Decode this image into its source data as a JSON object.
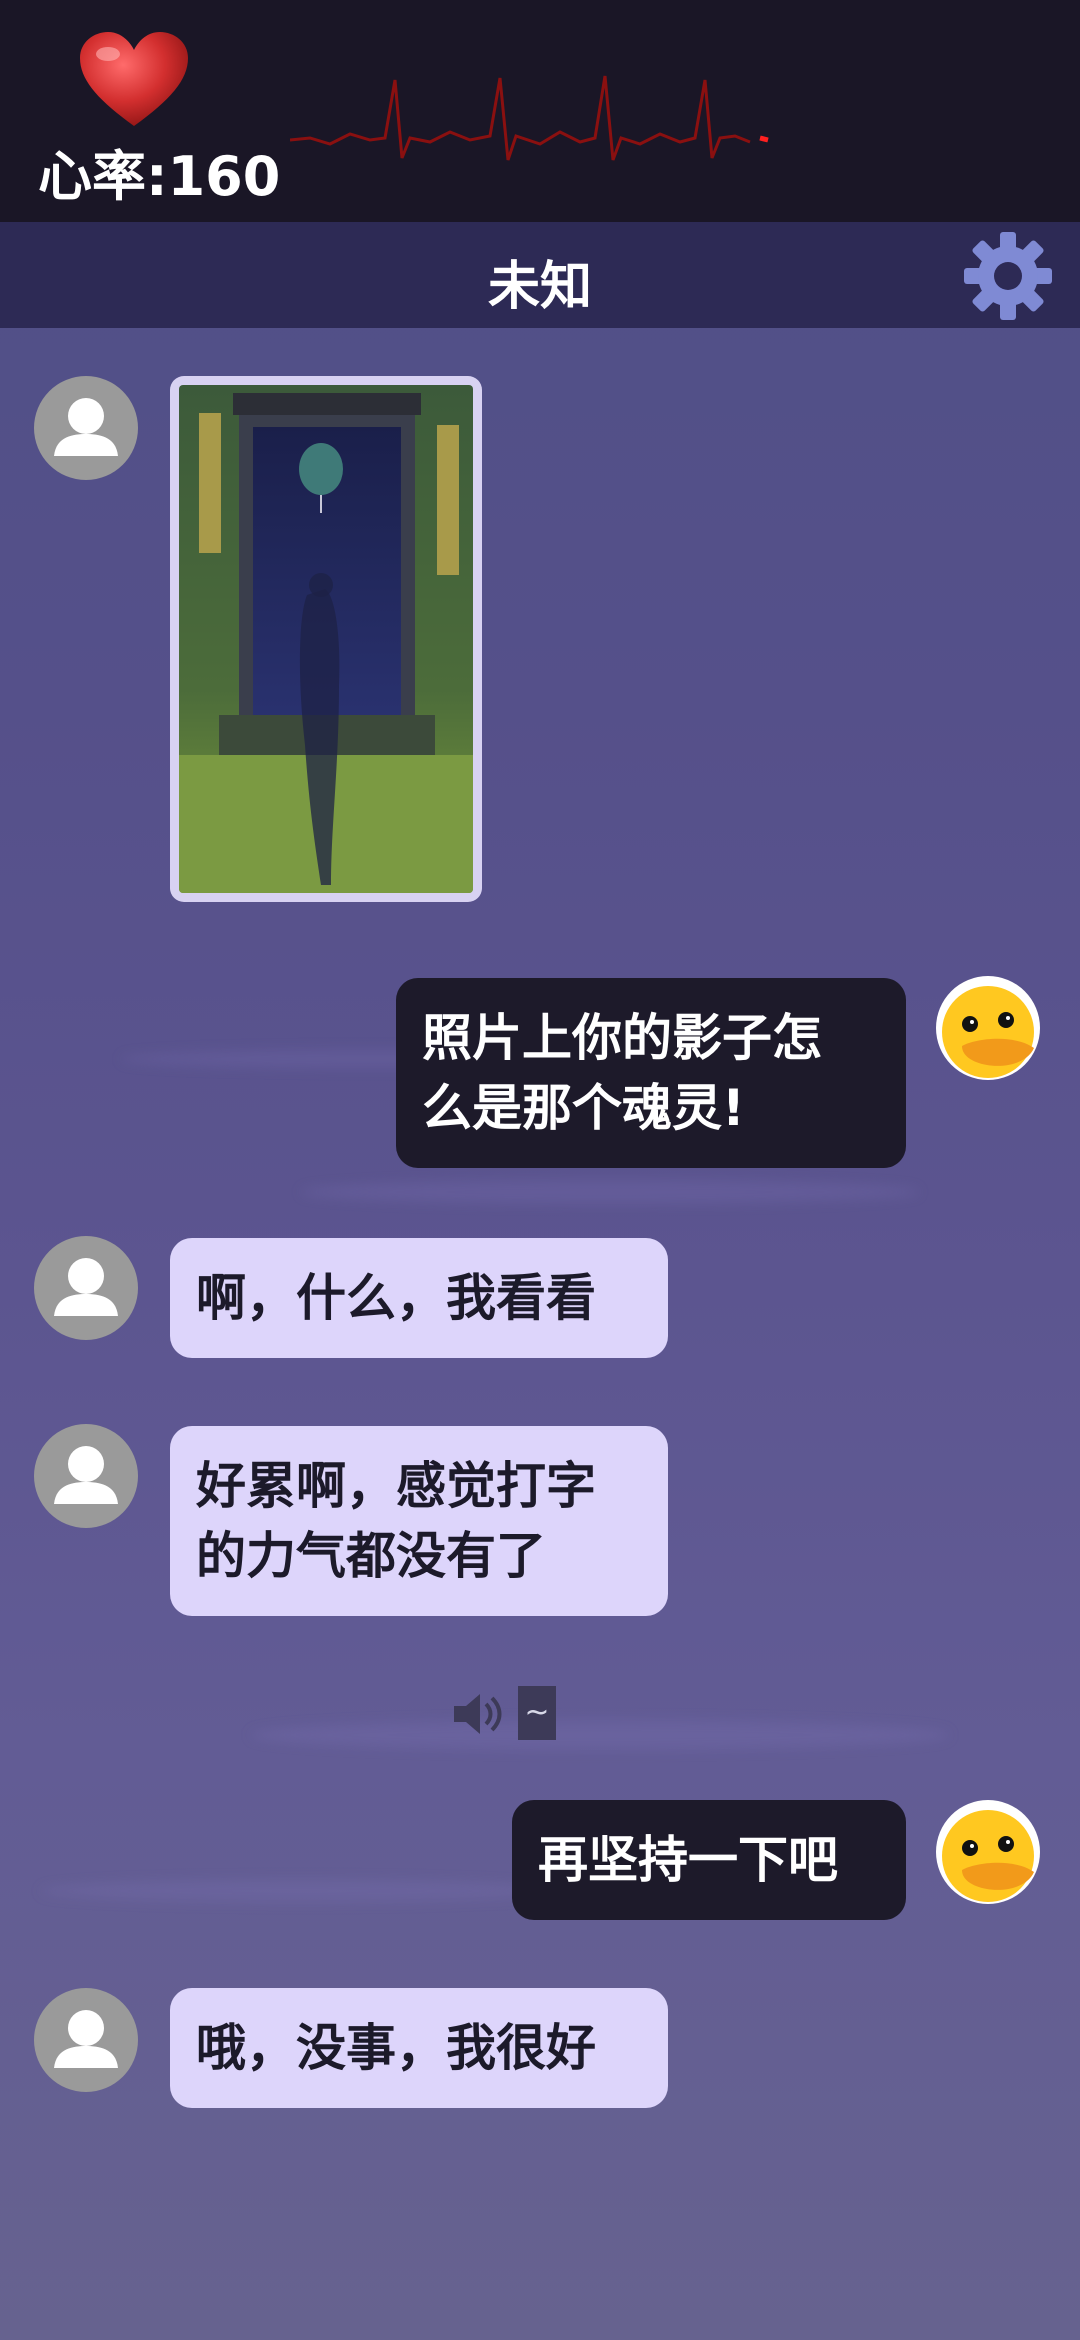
{
  "status": {
    "heart_rate_label": "心率:160",
    "heart_icon": "heart-icon",
    "heart_color": "#c62828",
    "ecg_color": "#b01818"
  },
  "header": {
    "title": "未知",
    "settings_icon": "gear-icon",
    "bar_color": "#2d2a55"
  },
  "messages": [
    {
      "side": "left",
      "type": "image",
      "avatar": "default-user-avatar"
    },
    {
      "side": "right",
      "type": "text",
      "avatar": "duck-avatar",
      "text": "照片上你的影子怎\n么是那个魂灵!"
    },
    {
      "side": "left",
      "type": "text",
      "avatar": "default-user-avatar",
      "text": "啊，什么，我看看"
    },
    {
      "side": "left",
      "type": "text",
      "avatar": "default-user-avatar",
      "text": "好累啊，感觉打字\n的力气都没有了"
    },
    {
      "side": "center",
      "type": "voice",
      "text": "~"
    },
    {
      "side": "right",
      "type": "text",
      "avatar": "duck-avatar",
      "text": "再坚持一下吧"
    },
    {
      "side": "left",
      "type": "text",
      "avatar": "default-user-avatar",
      "text": "哦，没事，我很好"
    }
  ],
  "colors": {
    "incoming_bubble": "#ddd5fb",
    "outgoing_bubble": "#1d1a2a"
  }
}
